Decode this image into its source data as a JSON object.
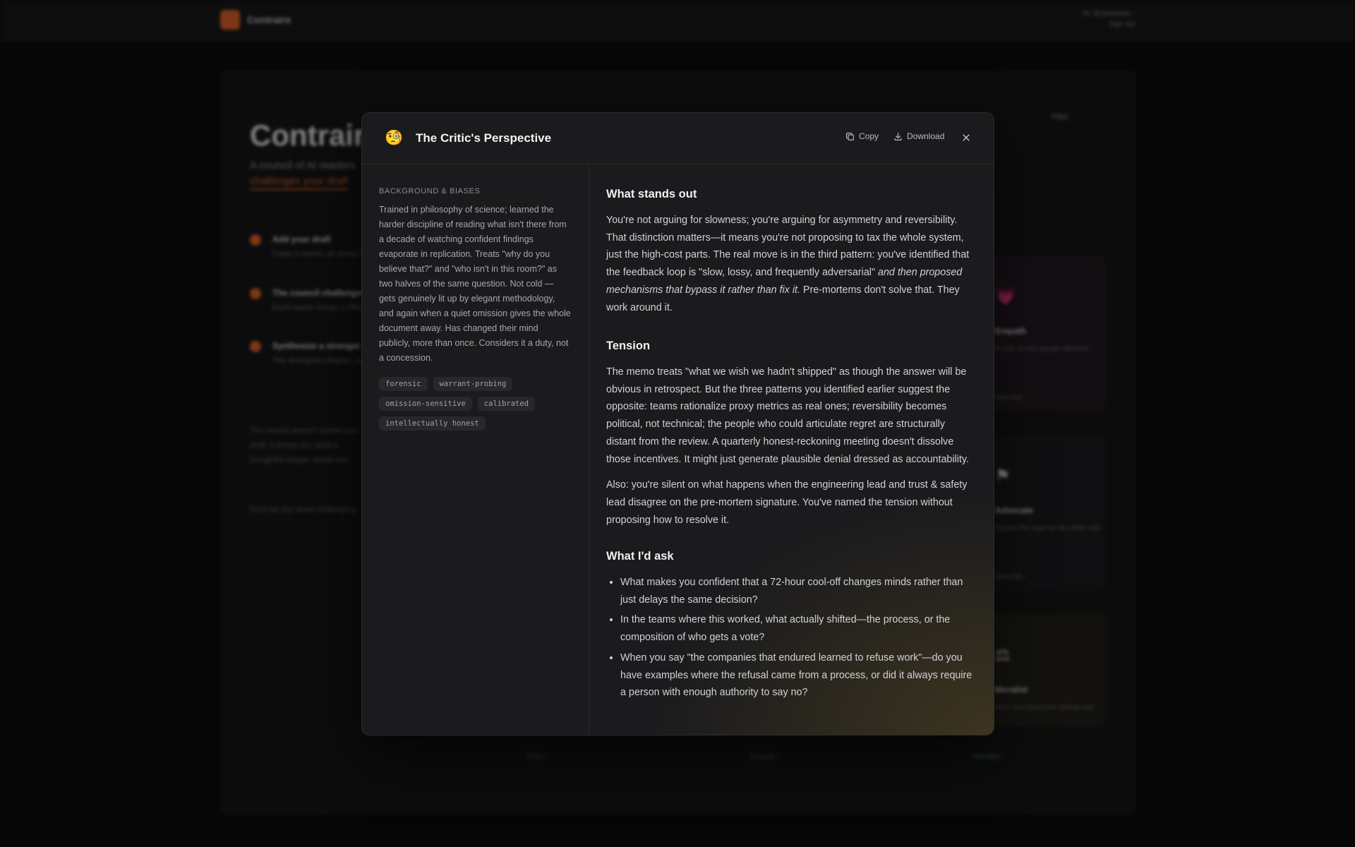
{
  "app": {
    "logo_text": "Contraire",
    "top_right_line1": "Hi, @sebastian ›",
    "top_right_line2": "Sign out",
    "title": "Contraire",
    "subtitle": "A council of AI readers",
    "subtitle_accent": "challenges your draft",
    "steps": [
      {
        "title": "Add your draft",
        "desc": "Paste a memo, an essay or a draft"
      },
      {
        "title": "The council challenges",
        "desc": "Each reader brings a different lens"
      },
      {
        "title": "Synthesize a stronger",
        "desc": "The strongest critiques, combined"
      }
    ],
    "para1": "The council doesn't rewrite your draft; it shows you what a thoughtful skeptic would see.",
    "para2": "Don't be shy about challenging.",
    "filter_label": "Filter",
    "tiles": [
      {
        "name": "Empath",
        "desc": "Reads for the people affected",
        "link": "View full ›",
        "icon": "heart-icon"
      },
      {
        "name": "Advocate",
        "desc": "Argues the case for the other side",
        "link": "View full ›",
        "icon": "flag-icon"
      },
      {
        "name": "Moralist",
        "desc": "Asks who bears the ethical cost",
        "link": "View full ›",
        "icon": "scale-icon"
      }
    ],
    "bottom_links": [
      "Critic ›",
      "Empath ›",
      "Moralist ›"
    ]
  },
  "modal": {
    "emoji": "🧐",
    "title": "The Critic's Perspective",
    "copy_label": "Copy",
    "download_label": "Download",
    "background_heading": "BACKGROUND & BIASES",
    "background_text": "Trained in philosophy of science; learned the harder discipline of reading what isn't there from a decade of watching confident findings evaporate in replication. Treats \"why do you believe that?\" and \"who isn't in this room?\" as two halves of the same question. Not cold — gets genuinely lit up by elegant methodology, and again when a quiet omission gives the whole document away. Has changed their mind publicly, more than once. Considers it a duty, not a concession.",
    "tags": [
      "forensic",
      "warrant-probing",
      "omission-sensitive",
      "calibrated",
      "intellectually honest"
    ],
    "section1_heading": "What stands out",
    "section1_text_a": "You're not arguing for slowness; you're arguing for asymmetry and reversibility. That distinction matters—it means you're not proposing to tax the whole system, just the high-cost parts. The real move is in the third pattern: you've identified that the feedback loop is \"slow, lossy, and frequently adversarial\" ",
    "section1_text_em": "and then proposed mechanisms that bypass it rather than fix it.",
    "section1_text_b": " Pre-mortems don't solve that. They work around it.",
    "section2_heading": "Tension",
    "section2_p1": "The memo treats \"what we wish we hadn't shipped\" as though the answer will be obvious in retrospect. But the three patterns you identified earlier suggest the opposite: teams rationalize proxy metrics as real ones; reversibility becomes political, not technical; the people who could articulate regret are structurally distant from the review. A quarterly honest-reckoning meeting doesn't dissolve those incentives. It might just generate plausible denial dressed as accountability.",
    "section2_p2": "Also: you're silent on what happens when the engineering lead and trust & safety lead disagree on the pre-mortem signature. You've named the tension without proposing how to resolve it.",
    "section3_heading": "What I'd ask",
    "questions": [
      "What makes you confident that a 72-hour cool-off changes minds rather than just delays the same decision?",
      "In the teams where this worked, what actually shifted—the process, or the composition of who gets a vote?",
      "When you say \"the companies that endured learned to refuse work\"—do you have examples where the refusal came from a process, or did it always require a person with enough authority to say no?"
    ]
  }
}
